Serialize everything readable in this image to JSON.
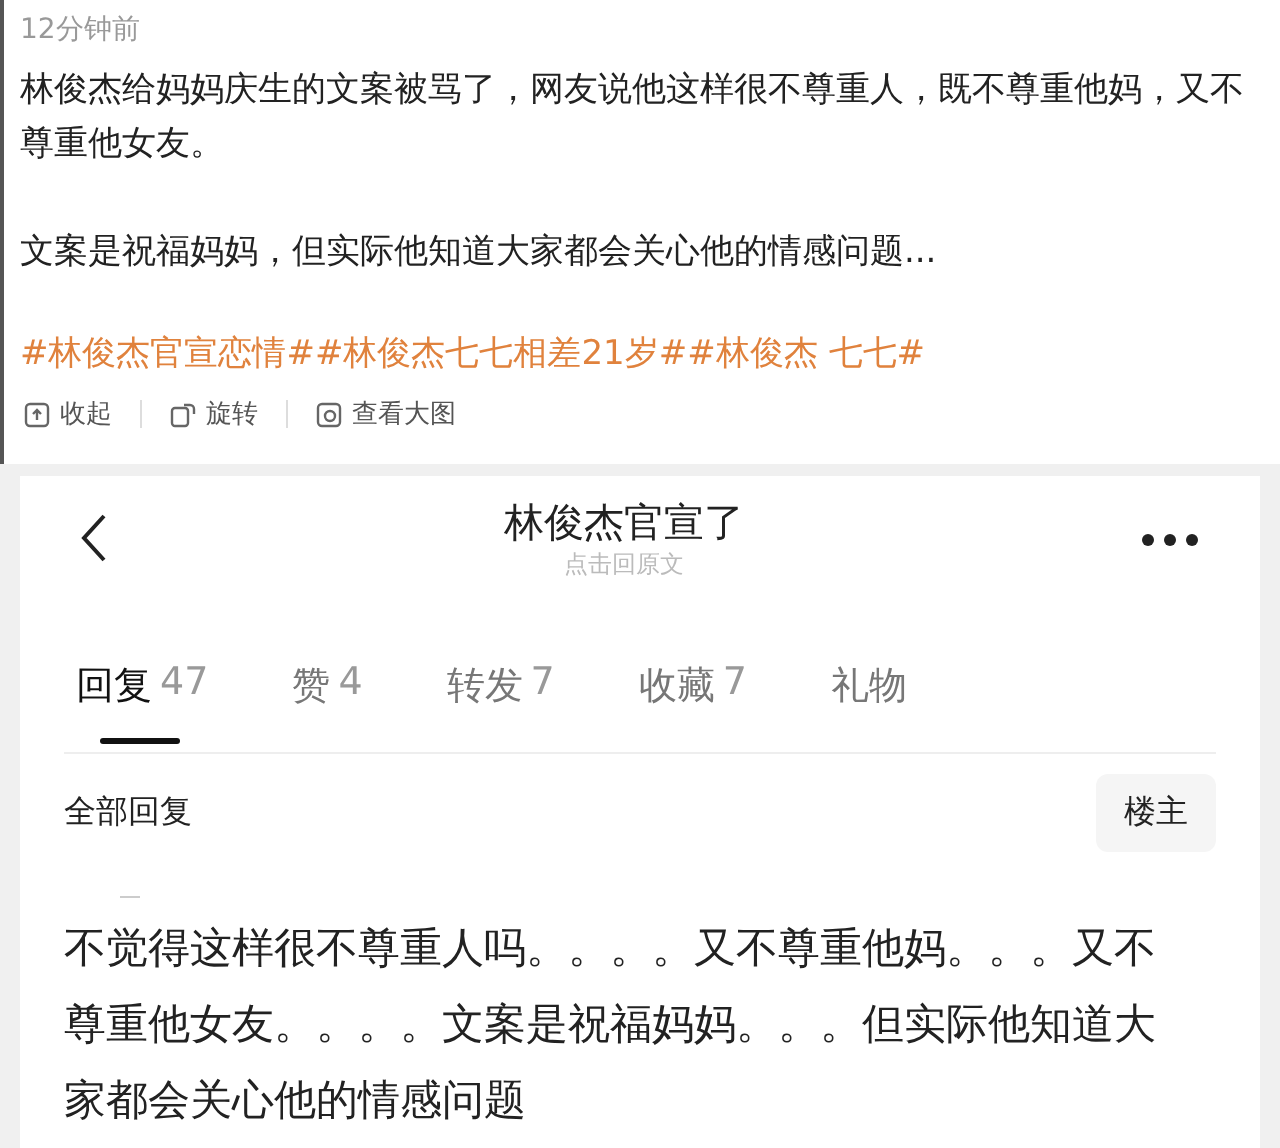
{
  "post": {
    "time": "12分钟前",
    "paragraphs": [
      "林俊杰给妈妈庆生的文案被骂了，网友说他这样很不尊重人，既不尊重他妈，又不尊重他女友。",
      "文案是祝福妈妈，但实际他知道大家都会关心他的情感问题..."
    ],
    "hashtags": "#林俊杰官宣恋情##林俊杰七七相差21岁##林俊杰 七七#",
    "actions": [
      {
        "kind": "collapse",
        "label": "收起"
      },
      {
        "kind": "rotate",
        "label": "旋转"
      },
      {
        "kind": "zoom",
        "label": "查看大图"
      }
    ]
  },
  "thread": {
    "title": "林俊杰官宣了",
    "subtitle": "点击回原文",
    "tabs": [
      {
        "label": "回复",
        "count": "47",
        "selected": true
      },
      {
        "label": "赞",
        "count": "4",
        "selected": false
      },
      {
        "label": "转发",
        "count": "7",
        "selected": false
      },
      {
        "label": "收藏",
        "count": "7",
        "selected": false
      },
      {
        "label": "礼物",
        "selected": false
      }
    ],
    "filter": "全部回复",
    "owner_button": "楼主",
    "comment": "不觉得这样很不尊重人吗。。。。又不尊重他妈。。。又不尊重他女友。。。。文案是祝福妈妈。。。但实际他知道大家都会关心他的情感问题"
  }
}
